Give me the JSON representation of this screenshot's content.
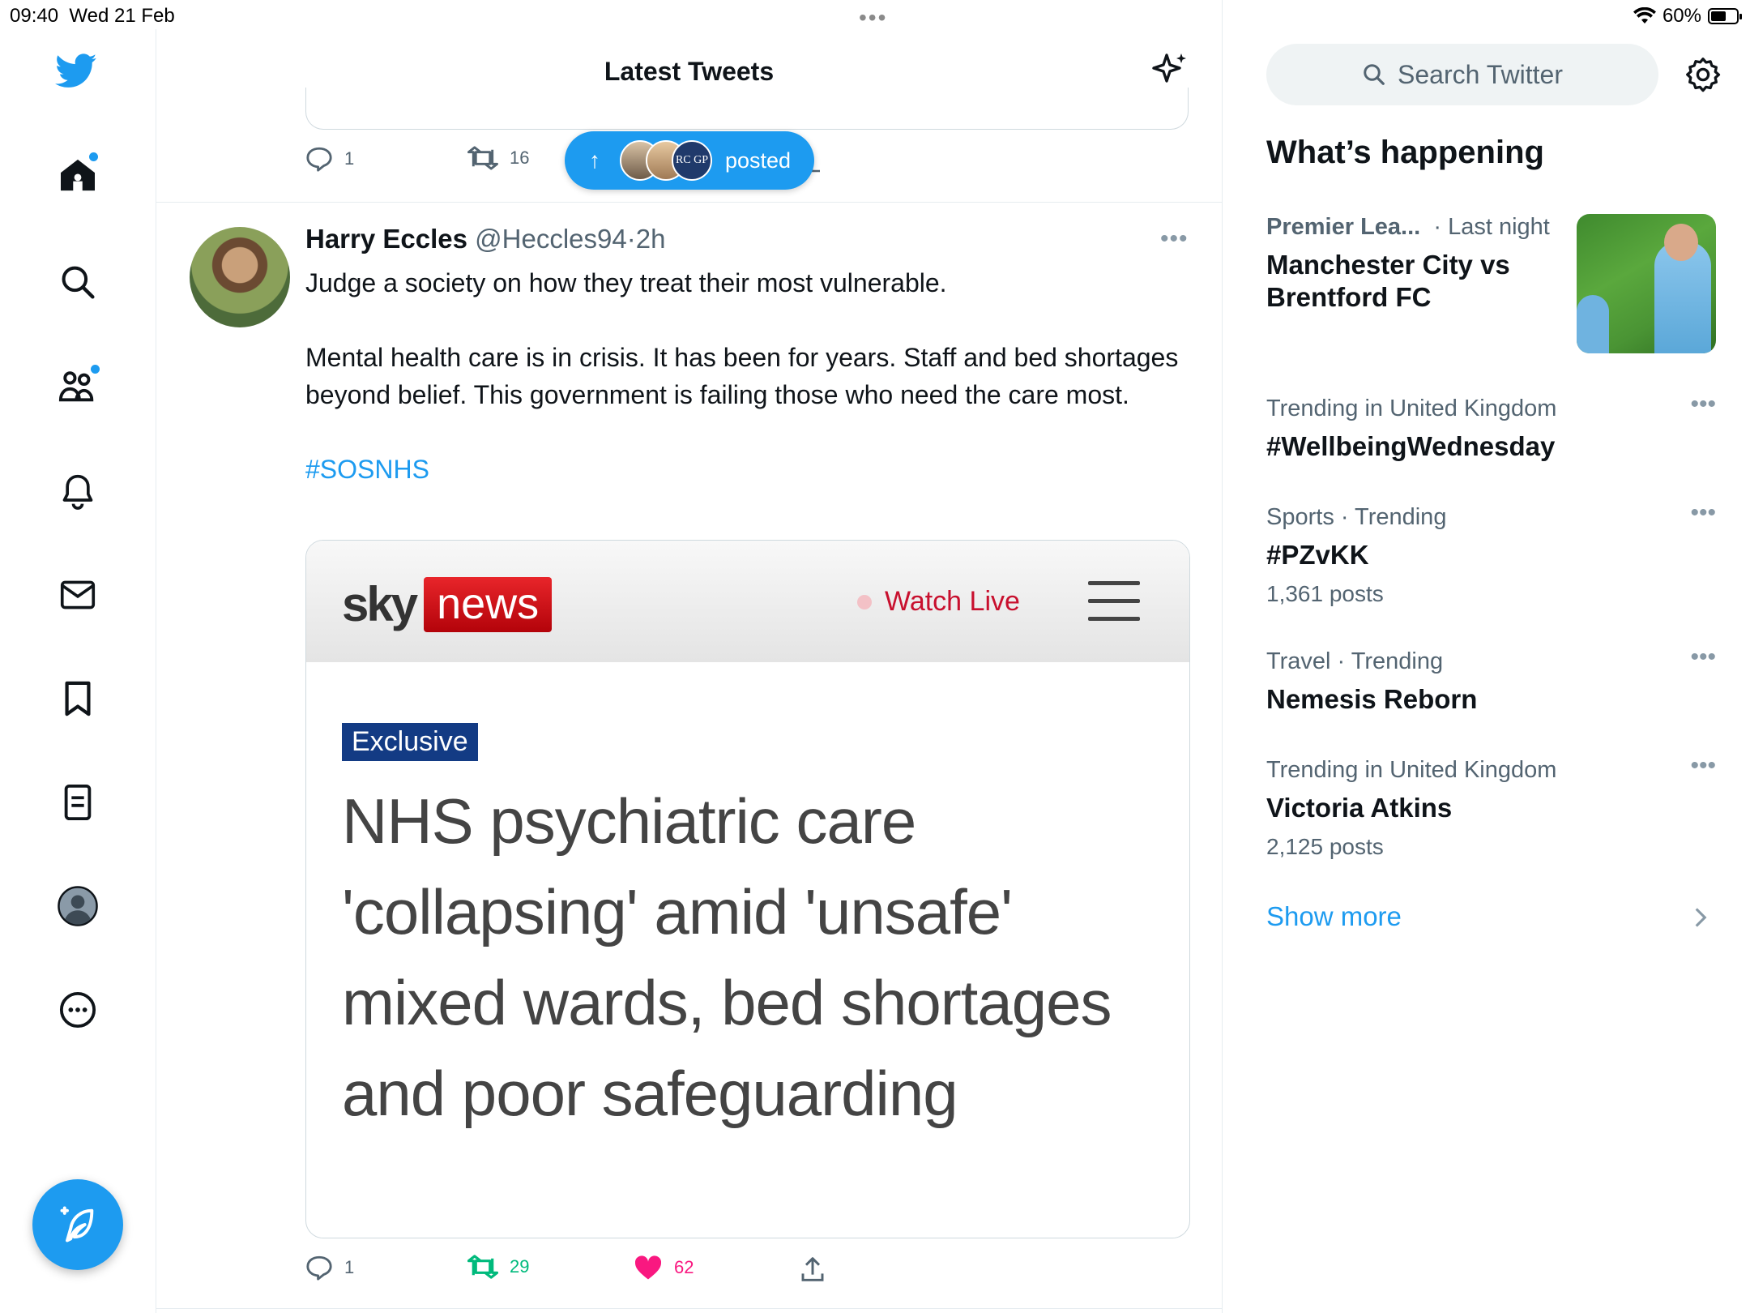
{
  "status_bar": {
    "time": "09:40",
    "date": "Wed 21 Feb",
    "battery": "60%",
    "battery_level": 0.6
  },
  "header": {
    "title": "Latest Tweets"
  },
  "nav": {
    "items": [
      "twitter-logo",
      "home",
      "explore",
      "communities",
      "notifications",
      "messages",
      "bookmarks",
      "lists",
      "profile",
      "more"
    ],
    "compose_label": "Tweet"
  },
  "prev_tweet": {
    "replies": "1",
    "retweets": "16"
  },
  "new_posts_pill": {
    "label": "posted",
    "avatars": [
      "avatar-1",
      "avatar-2",
      "rcgp-avatar"
    ],
    "rcgp_text": "RC GP"
  },
  "tweet": {
    "author_name": "Harry Eccles",
    "author_handle": "@Heccles94",
    "separator": "·",
    "time": "2h",
    "paragraph1": "Judge a society on how they treat their most vulnerable.",
    "paragraph2": "Mental health care is in crisis. It has been for years. Staff and bed shortages beyond belief. This government is failing those who need the care most.",
    "hashtag": "#SOSNHS",
    "card": {
      "brand_sky": "sky",
      "brand_news": "news",
      "watch_live": "Watch Live",
      "badge": "Exclusive",
      "headline": "NHS psychiatric care 'collapsing' amid 'unsafe' mixed wards, bed shortages and poor safeguarding"
    },
    "replies": "1",
    "retweets": "29",
    "likes": "62"
  },
  "sidebar": {
    "search_placeholder": "Search Twitter",
    "section_title": "What’s happening",
    "featured": {
      "category": "Premier Lea...",
      "separator": "·",
      "time": "Last night",
      "title": "Manchester City vs Brentford FC"
    },
    "trends": [
      {
        "meta": "Trending in United Kingdom",
        "name": "#WellbeingWednesday",
        "count": ""
      },
      {
        "meta": "Sports · Trending",
        "name": "#PZvKK",
        "count": "1,361 posts"
      },
      {
        "meta": "Travel · Trending",
        "name": "Nemesis Reborn",
        "count": ""
      },
      {
        "meta": "Trending in United Kingdom",
        "name": "Victoria Atkins",
        "count": "2,125 posts"
      }
    ],
    "show_more": "Show more"
  },
  "colors": {
    "accent": "#1d9bf0",
    "like": "#f91880",
    "retweet_active": "#00ba7c",
    "sky_red": "#c8102e",
    "exclusive_bg": "#133b84"
  }
}
